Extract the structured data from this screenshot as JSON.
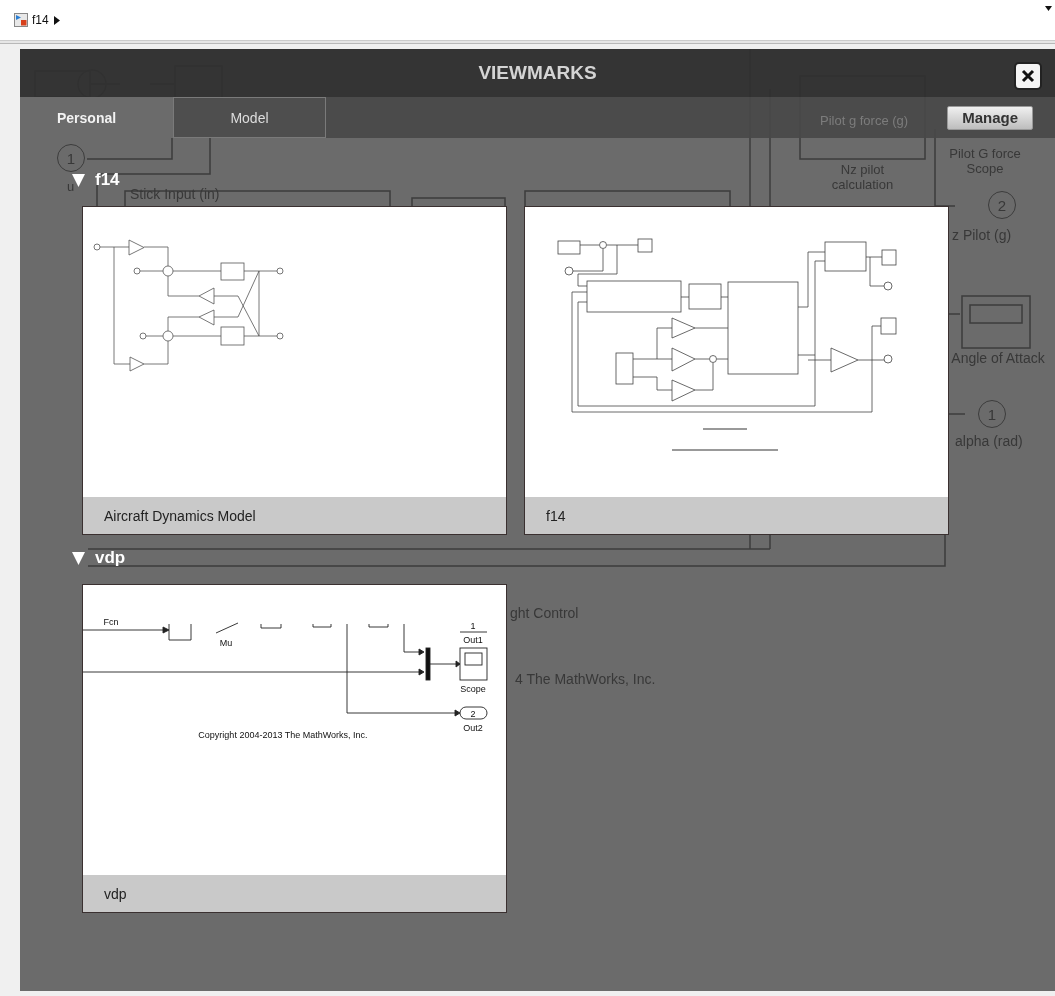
{
  "breadcrumb": {
    "model": "f14"
  },
  "background_model": {
    "inport_number": "1",
    "inport_name": "u",
    "stick_input": "Stick Input (in)",
    "nz_block_signal": "Pilot g force (g)",
    "nz_block": "Nz pilot calculation",
    "pilot_scope": "Pilot G force Scope",
    "outport2_number": "2",
    "outport2": "z Pilot (g)",
    "aoa_scope": "Angle of Attack",
    "outport1_number": "1",
    "outport1": "alpha (rad)",
    "title_fragment": "ght Control",
    "copyright_fragment": "4 The MathWorks, Inc."
  },
  "viewmarks": {
    "title": "VIEWMARKS",
    "manage_button": "Manage",
    "tabs": [
      {
        "label": "Personal",
        "selected": true
      },
      {
        "label": "Model",
        "selected": false
      }
    ],
    "groups": [
      {
        "name": "f14",
        "expanded": true,
        "items": [
          {
            "label": "Aircraft Dynamics Model",
            "kind": "aircraft"
          },
          {
            "label": "f14",
            "kind": "f14"
          }
        ]
      },
      {
        "name": "vdp",
        "expanded": true,
        "items": [
          {
            "label": "vdp",
            "kind": "vdp",
            "texts": {
              "fcn": "Fcn",
              "mu": "Mu",
              "out1_number": "1",
              "out1": "Out1",
              "scope": "Scope",
              "out2_number": "2",
              "out2": "Out2",
              "copyright": "Copyright 2004-2013 The MathWorks, Inc."
            }
          }
        ]
      }
    ]
  }
}
